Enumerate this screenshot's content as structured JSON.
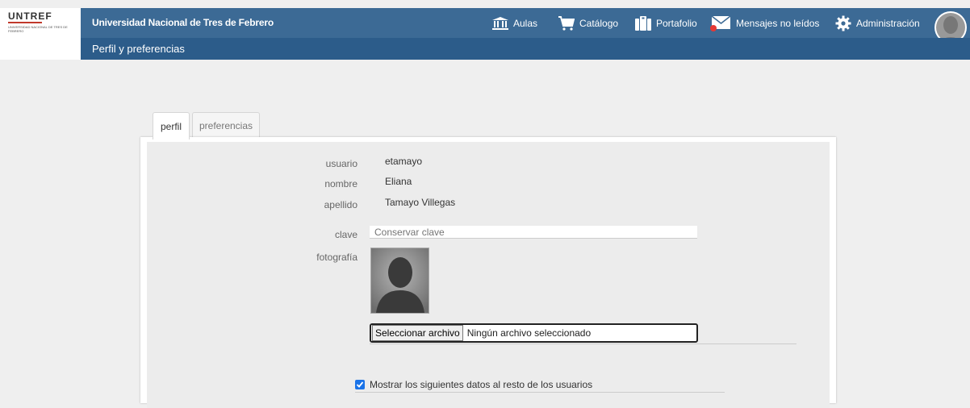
{
  "logo": {
    "text": "UNTREF",
    "subtext": "Universidad Nacional de Tres de Febrero"
  },
  "header": {
    "title": "Universidad Nacional de Tres de Febrero",
    "subtitle": "Perfil y preferencias",
    "nav": [
      {
        "label": "Aulas",
        "icon": "institution-icon"
      },
      {
        "label": "Catálogo",
        "icon": "cart-icon"
      },
      {
        "label": "Portafolio",
        "icon": "briefcase-icon"
      },
      {
        "label": "Mensajes no leídos",
        "icon": "envelope-icon"
      },
      {
        "label": "Administración",
        "icon": "gear-icon"
      }
    ]
  },
  "tabs": [
    {
      "label": "perfil",
      "active": true
    },
    {
      "label": "preferencias",
      "active": false
    }
  ],
  "profile": {
    "usuario_label": "usuario",
    "usuario": "etamayo",
    "nombre_label": "nombre",
    "nombre": "Eliana",
    "apellido_label": "apellido",
    "apellido": "Tamayo Villegas",
    "clave_label": "clave",
    "clave_placeholder": "Conservar clave",
    "foto_label": "fotografía",
    "file_button": "Seleccionar archivo",
    "file_status": "Ningún archivo seleccionado",
    "show_data_label": "Mostrar los siguientes datos al resto de los usuarios",
    "show_data_checked": true
  },
  "colors": {
    "header": "#3c6a95",
    "subheader": "#2c5c8a",
    "checkbox": "#1a73e8",
    "notify_dot": "#e53935"
  }
}
